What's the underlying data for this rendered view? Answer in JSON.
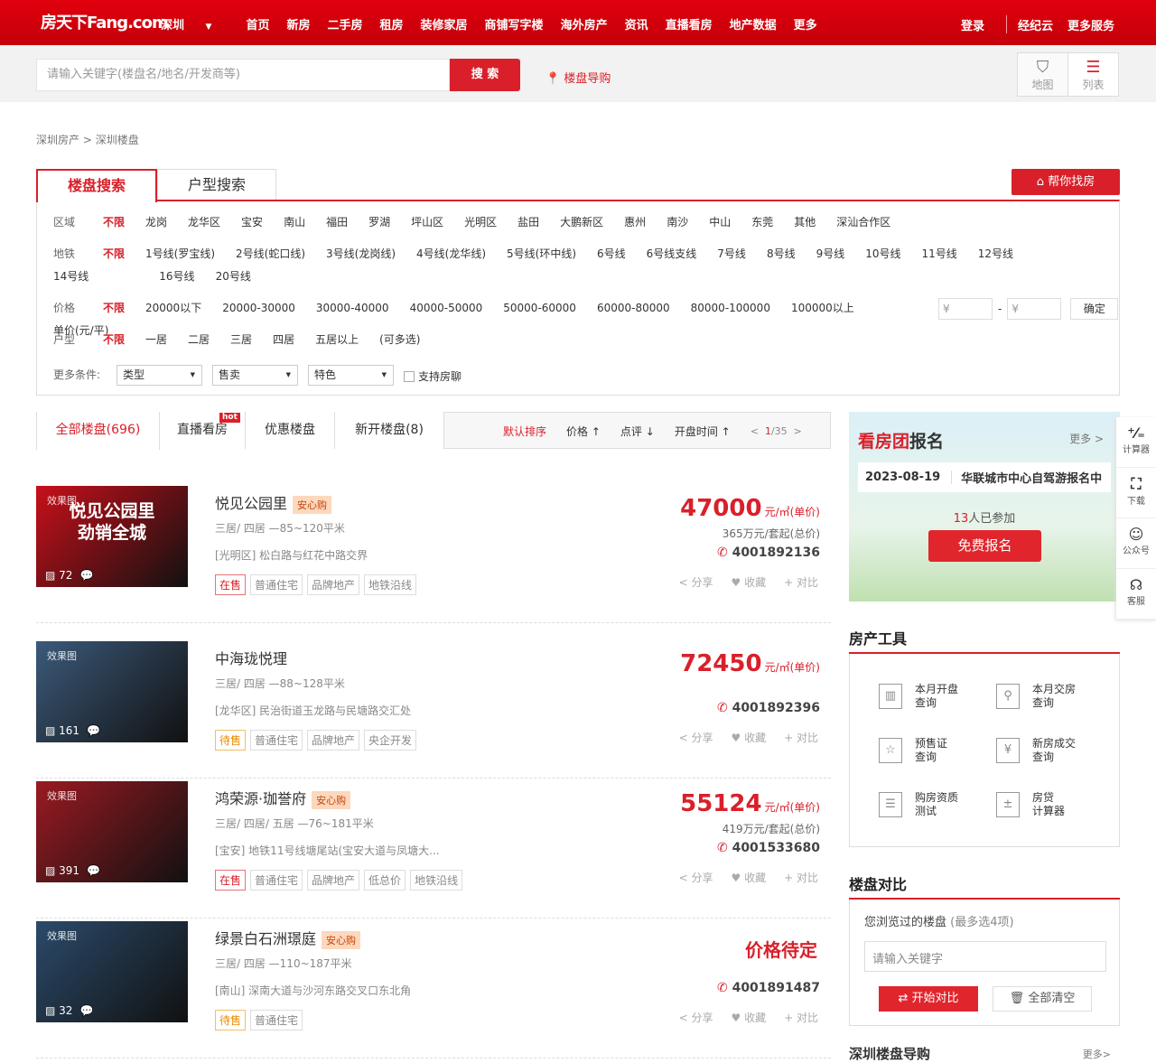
{
  "header": {
    "logo": "房天下Fang.com",
    "city": "深圳",
    "nav": [
      "首页",
      "新房",
      "二手房",
      "租房",
      "装修家居",
      "商铺写字楼",
      "海外房产",
      "资讯",
      "直播看房",
      "地产数据",
      "更多"
    ],
    "login": "登录",
    "jingjiyun": "经纪云",
    "more_services": "更多服务"
  },
  "search": {
    "placeholder": "请输入关键字(楼盘名/地名/开发商等)",
    "button": "搜 索",
    "guide": "楼盘导购",
    "map": "地图",
    "list": "列表"
  },
  "breadcrumb": [
    "深圳房产",
    "深圳楼盘"
  ],
  "search_tabs": [
    "楼盘搜索",
    "户型搜索"
  ],
  "help_find": "帮你找房",
  "filters": {
    "district": {
      "label": "区域",
      "options": [
        "不限",
        "龙岗",
        "龙华区",
        "宝安",
        "南山",
        "福田",
        "罗湖",
        "坪山区",
        "光明区",
        "盐田",
        "大鹏新区",
        "惠州",
        "南沙",
        "中山",
        "东莞",
        "其他",
        "深汕合作区"
      ]
    },
    "subway": {
      "label": "地铁",
      "options": [
        "不限",
        "1号线(罗宝线)",
        "2号线(蛇口线)",
        "3号线(龙岗线)",
        "4号线(龙华线)",
        "5号线(环中线)",
        "6号线",
        "6号线支线",
        "7号线",
        "8号线",
        "9号线",
        "10号线",
        "11号线",
        "12号线",
        "14号线",
        "16号线",
        "20号线"
      ]
    },
    "price": {
      "label": "价格",
      "options": [
        "不限",
        "20000以下",
        "20000-30000",
        "30000-40000",
        "40000-50000",
        "50000-60000",
        "60000-80000",
        "80000-100000",
        "100000以上",
        "单价(元/平)"
      ],
      "min_placeholder": "¥",
      "max_placeholder": "¥",
      "confirm": "确定"
    },
    "layout": {
      "label": "户型",
      "options": [
        "不限",
        "一居",
        "二居",
        "三居",
        "四居",
        "五居以上",
        "(可多选)"
      ]
    },
    "more": {
      "label": "更多条件:",
      "selects": [
        "类型",
        "售卖",
        "特色"
      ],
      "checkbox": "支持房聊"
    }
  },
  "list_tabs": [
    {
      "label": "全部楼盘(696)"
    },
    {
      "label": "直播看房",
      "hot": "hot"
    },
    {
      "label": "优惠楼盘"
    },
    {
      "label": "新开楼盘(8)"
    }
  ],
  "sort": {
    "default": "默认排序",
    "price": "价格",
    "review": "点评",
    "open_time": "开盘时间",
    "page": "1",
    "pages": "/35"
  },
  "actions": {
    "share": "分享",
    "fav": "收藏",
    "compare": "对比"
  },
  "listings": [
    {
      "img_tag": "效果图",
      "img_head": "悦见公园里\n劲销全城",
      "img_count": "72",
      "name": "悦见公园里",
      "badge": "安心购",
      "rooms": "三居/ 四居 —85~120平米",
      "addr": "[光明区] 松白路与红花中路交界",
      "tags": [
        "在售",
        "普通住宅",
        "品牌地产",
        "地铁沿线"
      ],
      "price": "47000",
      "unit": "元/㎡(单价)",
      "total": "365万元/套起(总价)",
      "tel": "4001892136",
      "bg": "#c8101a"
    },
    {
      "img_tag": "效果图",
      "img_head": "",
      "img_count": "161",
      "name": "中海珑悦理",
      "badge": "",
      "rooms": "三居/ 四居 —88~128平米",
      "addr": "[龙华区] 民治街道玉龙路与民塘路交汇处",
      "tags": [
        "待售",
        "普通住宅",
        "品牌地产",
        "央企开发"
      ],
      "price": "72450",
      "unit": "元/㎡(单价)",
      "total": "",
      "tel": "4001892396",
      "bg": "#3b5a7a"
    },
    {
      "img_tag": "效果图",
      "img_head": "",
      "img_count": "391",
      "name": "鸿荣源·珈誉府",
      "badge": "安心购",
      "rooms": "三居/ 四居/ 五居 —76~181平米",
      "addr": "[宝安] 地铁11号线塘尾站(宝安大道与凤塘大...",
      "tags": [
        "在售",
        "普通住宅",
        "品牌地产",
        "低总价",
        "地铁沿线"
      ],
      "price": "55124",
      "unit": "元/㎡(单价)",
      "total": "419万元/套起(总价)",
      "tel": "4001533680",
      "bg": "#9a1a22"
    },
    {
      "img_tag": "效果图",
      "img_head": "",
      "img_count": "32",
      "name": "绿景白石洲璟庭",
      "badge": "安心购",
      "rooms": "三居/ 四居 —110~187平米",
      "addr": "[南山] 深南大道与沙河东路交叉口东北角",
      "tags": [
        "待售",
        "普通住宅"
      ],
      "price": "价格待定",
      "unit": "",
      "total": "",
      "tel": "4001891487",
      "bg": "#2b4a6a"
    }
  ],
  "group": {
    "title_red": "看房团",
    "title": "报名",
    "more": "更多 >",
    "date": "2023-08-19",
    "event": "华联城市中心自驾游报名中",
    "count": "13",
    "joined": "人已参加",
    "button": "免费报名"
  },
  "tools_title": "房产工具",
  "tools": [
    {
      "l1": "本月开盘",
      "l2": "查询",
      "icon": "building-icon",
      "g": "▥"
    },
    {
      "l1": "本月交房",
      "l2": "查询",
      "icon": "key-icon",
      "g": "⚲"
    },
    {
      "l1": "预售证",
      "l2": "查询",
      "icon": "certificate-icon",
      "g": "☆"
    },
    {
      "l1": "新房成交",
      "l2": "查询",
      "icon": "yuan-icon",
      "g": "¥"
    },
    {
      "l1": "购房资质",
      "l2": "测试",
      "icon": "checklist-icon",
      "g": "☰"
    },
    {
      "l1": "房贷",
      "l2": "计算器",
      "icon": "calculator-icon",
      "g": "±"
    }
  ],
  "compare": {
    "title": "楼盘对比",
    "hint": "您浏览过的楼盘",
    "hint2": "(最多选4项)",
    "placeholder": "请输入关键字",
    "start": "开始对比",
    "clear": "全部清空"
  },
  "guide_title": "深圳楼盘导购",
  "guide_more": "更多>",
  "float_tools": [
    {
      "label": "计算器",
      "g": "⁺⁄₌",
      "icon": "calculator-icon"
    },
    {
      "label": "下载",
      "g": "⛶",
      "icon": "qr-scan-icon"
    },
    {
      "label": "公众号",
      "g": "☺",
      "icon": "wechat-icon"
    },
    {
      "label": "客服",
      "g": "☊",
      "icon": "headset-icon"
    }
  ],
  "colors": {
    "brand": "#d9202a"
  }
}
